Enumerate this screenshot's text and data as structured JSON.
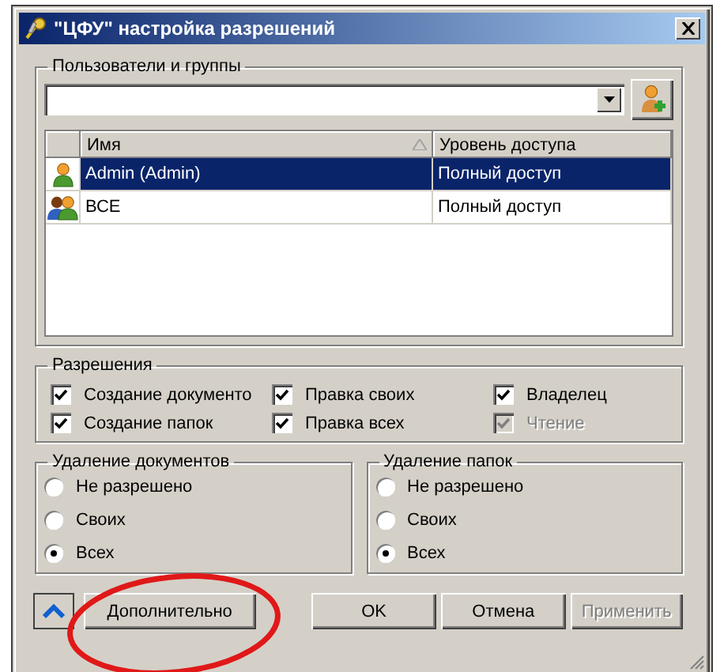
{
  "window": {
    "title": "\"ЦФУ\" настройка разрешений"
  },
  "users": {
    "title": "Пользователи и группы",
    "table": {
      "columns": [
        {
          "label": "Имя",
          "sorted": true
        },
        {
          "label": "Уровень доступа",
          "sorted": false
        }
      ],
      "rows": [
        {
          "kind": "user",
          "name": "Admin (Admin)",
          "access": "Полный доступ",
          "selected": true
        },
        {
          "kind": "group",
          "name": "ВСЕ",
          "access": "Полный доступ",
          "selected": false
        }
      ]
    }
  },
  "permissions": {
    "title": "Разрешения",
    "items": [
      {
        "label": "Создание документо",
        "checked": true,
        "disabled": false
      },
      {
        "label": "Правка своих",
        "checked": true,
        "disabled": false
      },
      {
        "label": "Владелец",
        "checked": true,
        "disabled": false
      },
      {
        "label": "Создание папок",
        "checked": true,
        "disabled": false
      },
      {
        "label": "Правка всех",
        "checked": true,
        "disabled": false
      },
      {
        "label": "Чтение",
        "checked": true,
        "disabled": true
      }
    ]
  },
  "deletion": [
    {
      "title": "Удаление документов",
      "options": [
        {
          "label": "Не разрешено",
          "selected": false
        },
        {
          "label": "Своих",
          "selected": false
        },
        {
          "label": "Всех",
          "selected": true
        }
      ]
    },
    {
      "title": "Удаление папок",
      "options": [
        {
          "label": "Не разрешено",
          "selected": false
        },
        {
          "label": "Своих",
          "selected": false
        },
        {
          "label": "Всех",
          "selected": true
        }
      ]
    }
  ],
  "buttons": [
    {
      "label": "Дополнительно",
      "disabled": false
    },
    {
      "label": "OK",
      "disabled": false
    },
    {
      "label": "Отмена",
      "disabled": false
    },
    {
      "label": "Применить",
      "disabled": true
    }
  ]
}
